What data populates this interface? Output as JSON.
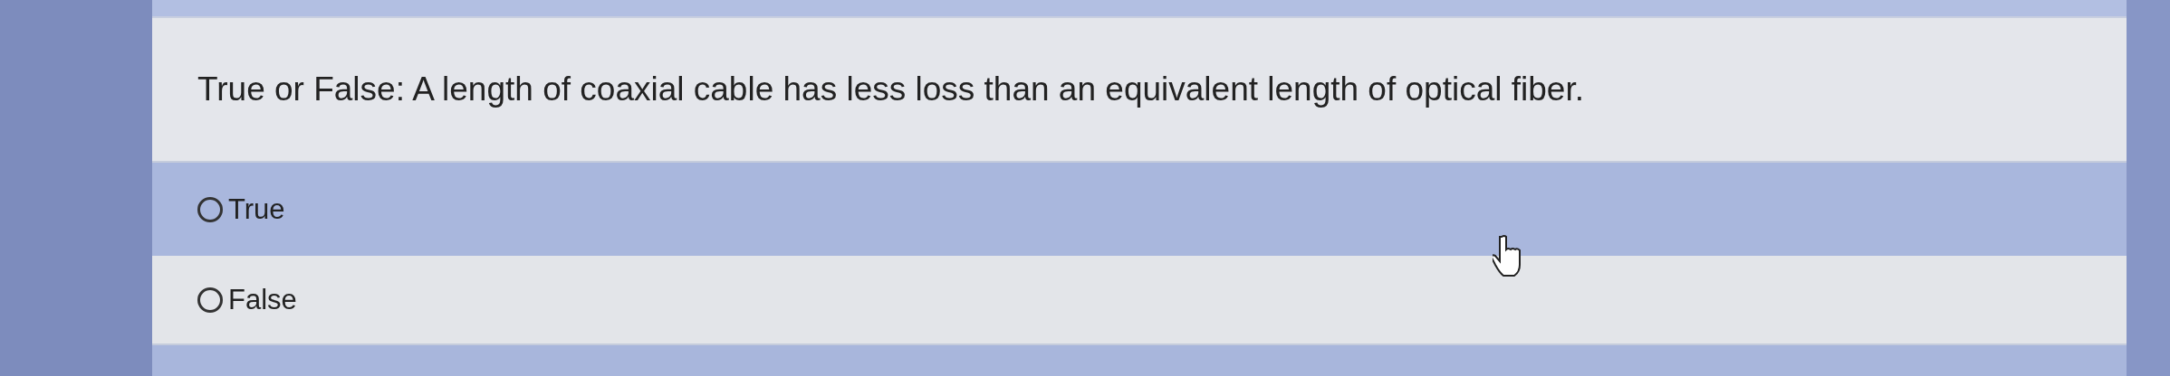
{
  "question": {
    "text": "True or False: A length of coaxial cable has less loss than an equivalent length of optical fiber."
  },
  "options": [
    {
      "label": "True",
      "selected": false
    },
    {
      "label": "False",
      "selected": false
    }
  ],
  "cursor": {
    "kind": "hand"
  }
}
